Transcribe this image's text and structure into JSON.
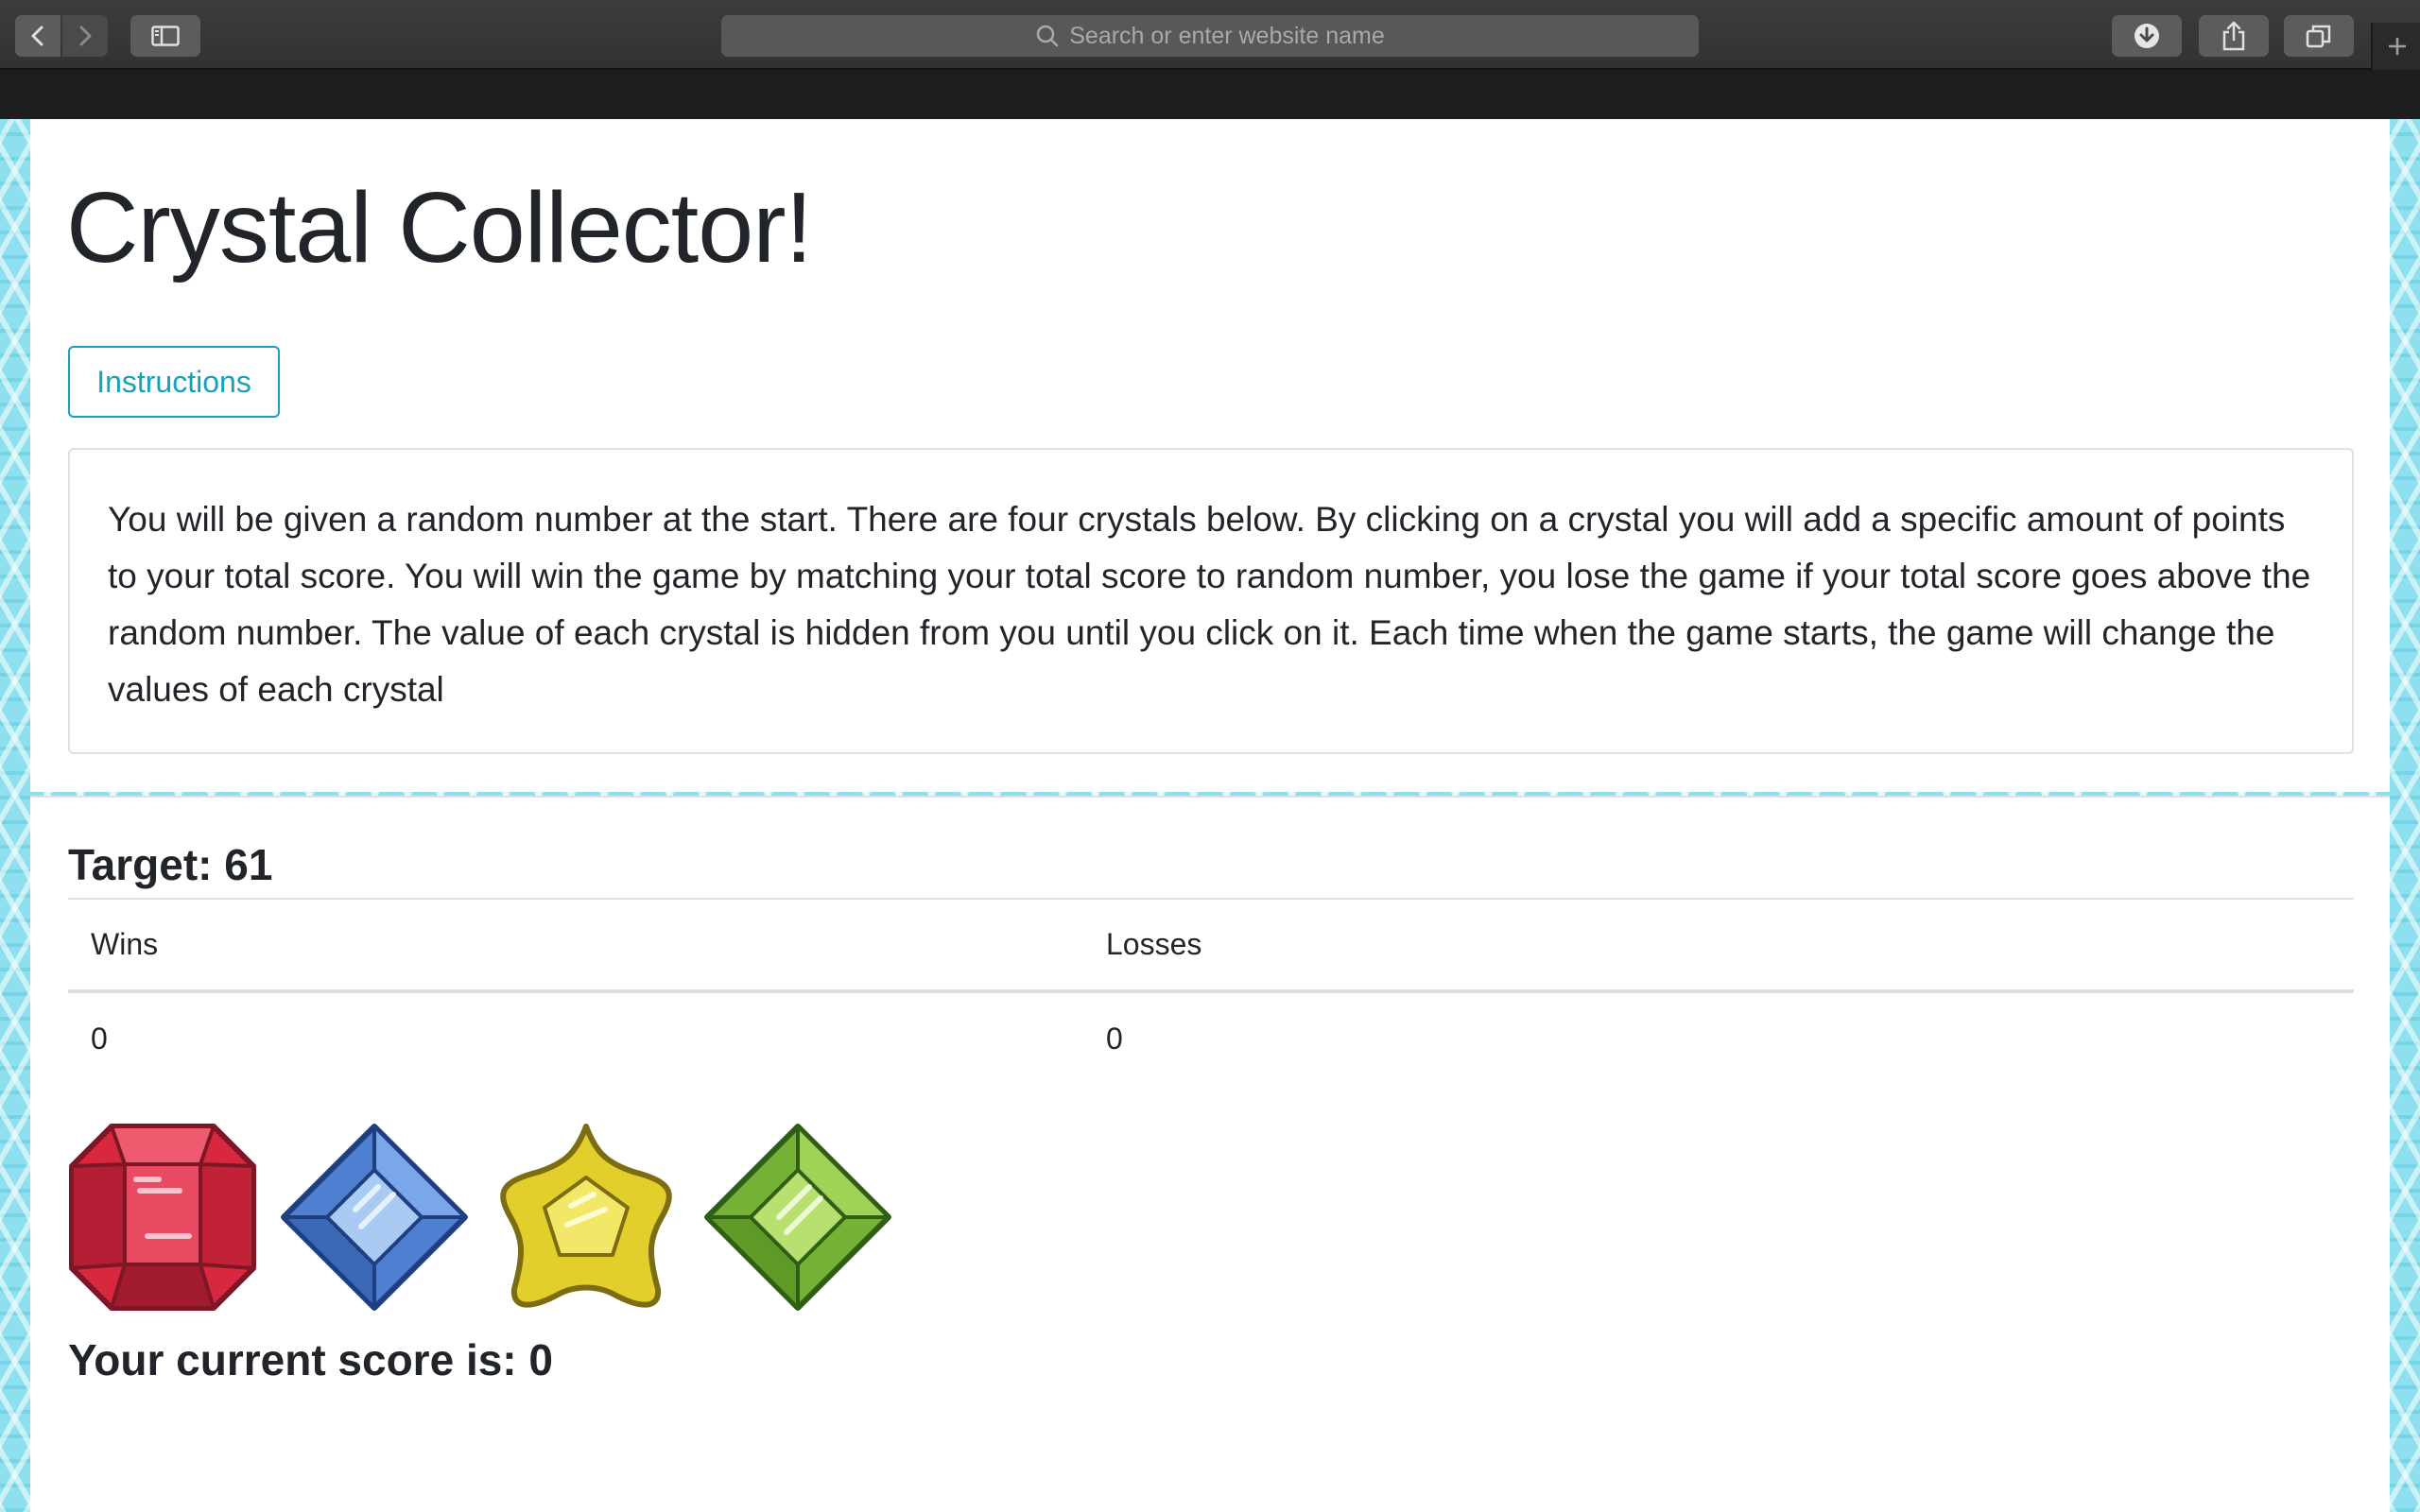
{
  "browser": {
    "address_placeholder": "Search or enter website name"
  },
  "page": {
    "title": "Crystal Collector!",
    "instructions_button": "Instructions",
    "instructions_text": "You will be given a random number at the start. There are four crystals below. By clicking on a crystal you will add a specific amount of points to your total score. You will win the game by matching your total score to random number, you lose the game if your total score goes above the random number. The value of each crystal is hidden from you until you click on it. Each time when the game starts, the game will change the values of each crystal"
  },
  "game": {
    "target": "Target: 61",
    "table": {
      "headers": [
        "Wins",
        "Losses"
      ],
      "values": [
        "0",
        "0"
      ]
    },
    "crystals": [
      "red-crystal-icon",
      "blue-crystal-icon",
      "yellow-crystal-icon",
      "green-crystal-icon"
    ],
    "current_score": "Your current score is: 0"
  },
  "colors": {
    "accent": "#17a2b8",
    "red_crystal": "#d8283f",
    "blue_crystal": "#5b8fdb",
    "yellow_crystal": "#eadb3c",
    "green_crystal": "#86c23c"
  }
}
